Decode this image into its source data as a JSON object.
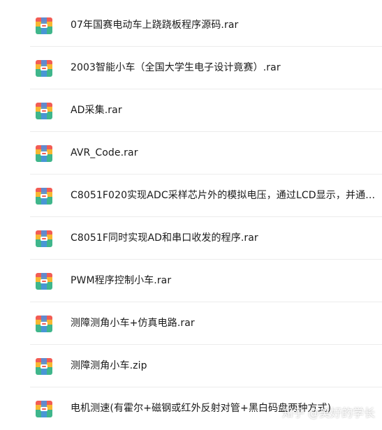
{
  "files": [
    {
      "name": "07年国赛电动车上跷跷板程序源码.rar",
      "icon": "archive-icon"
    },
    {
      "name": "2003智能小车（全国大学生电子设计竟赛）.rar",
      "icon": "archive-icon"
    },
    {
      "name": "AD采集.rar",
      "icon": "archive-icon"
    },
    {
      "name": "AVR_Code.rar",
      "icon": "archive-icon"
    },
    {
      "name": "C8051F020实现ADC采样芯片外的模拟电压，通过LCD显示，并通…",
      "icon": "archive-icon"
    },
    {
      "name": "C8051F同时实现AD和串口收发的程序.rar",
      "icon": "archive-icon"
    },
    {
      "name": "PWM程序控制小车.rar",
      "icon": "archive-icon"
    },
    {
      "name": "测障测角小车+仿真电路.rar",
      "icon": "archive-icon"
    },
    {
      "name": "测障测角小车.zip",
      "icon": "archive-icon"
    },
    {
      "name": "电机测速(有霍尔+磁钢或红外反射对管+黑白码盘两种方式)",
      "icon": "archive-icon"
    }
  ],
  "watermark": "知乎 @美好的学长",
  "colors": {
    "icon_top": "#f25c54",
    "icon_mid": "#f7b731",
    "icon_bottom": "#3fb68b",
    "icon_band": "#4a90e2",
    "divider": "#ececec",
    "text": "#1a1a1a"
  }
}
